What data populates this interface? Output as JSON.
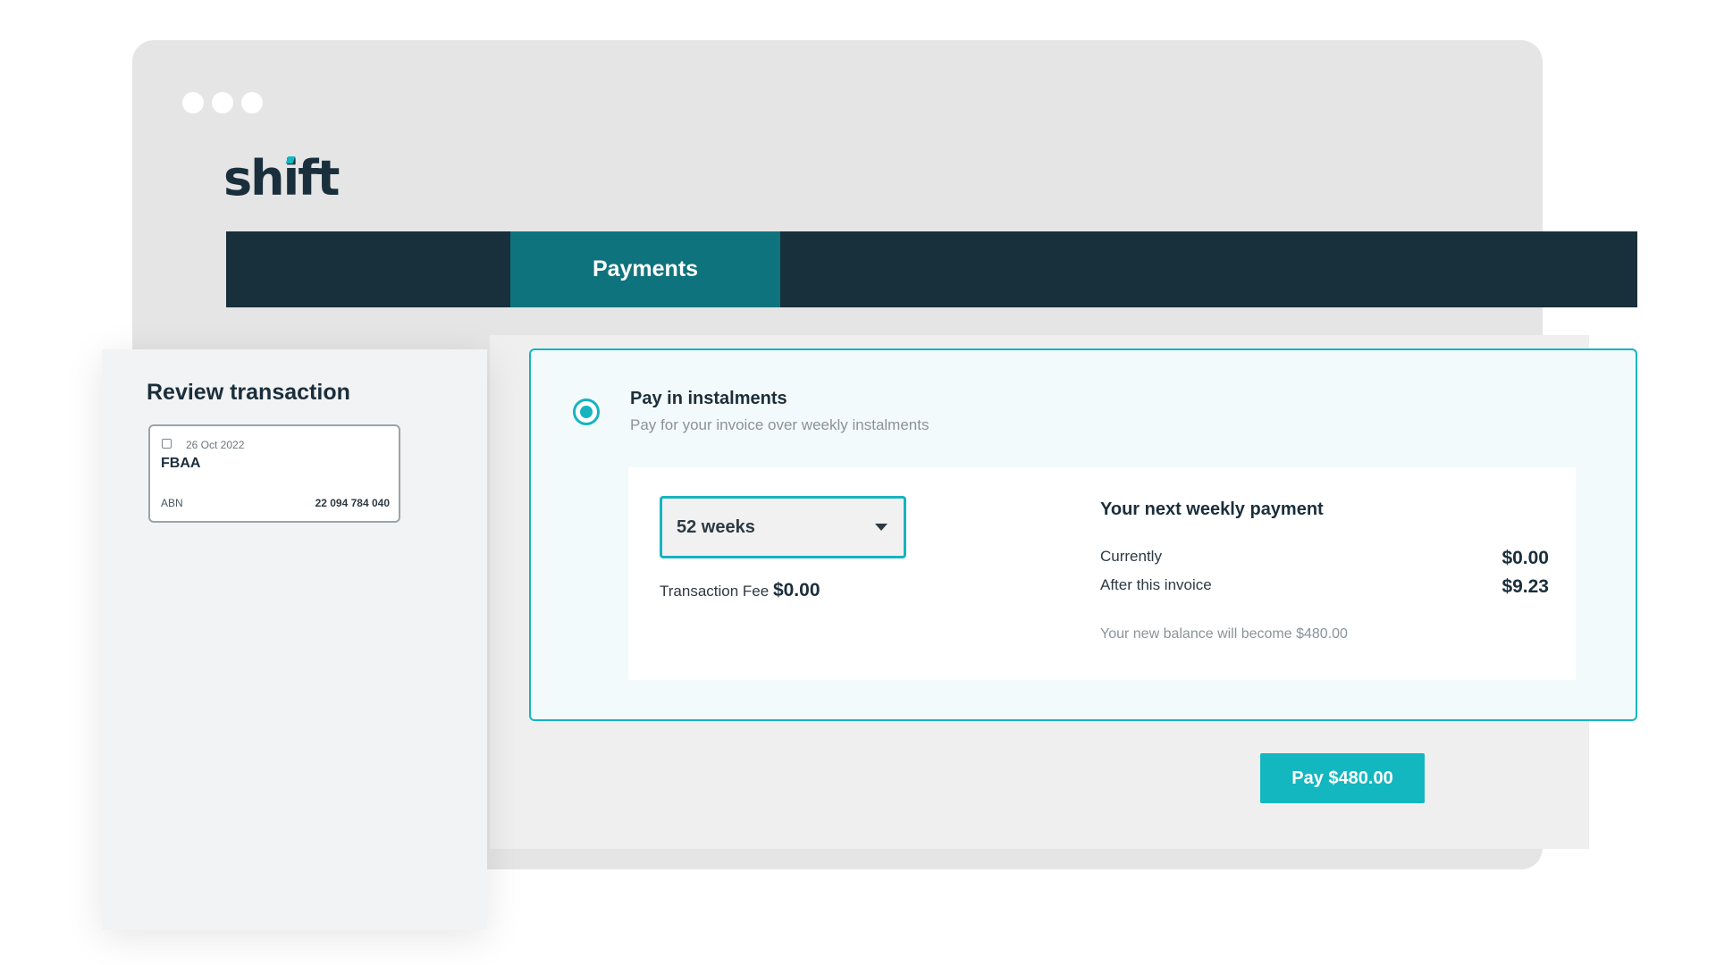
{
  "app": {
    "logo_text": "shift",
    "window_controls": [
      "dot",
      "dot",
      "dot"
    ]
  },
  "nav": {
    "active_tab": "Payments"
  },
  "review": {
    "title": "Review transaction",
    "transaction": {
      "date": "26 Oct 2022",
      "name": "FBAA",
      "abn_label": "ABN",
      "abn_value": "22 094 784 040"
    }
  },
  "instalments": {
    "title": "Pay in instalments",
    "subtitle": "Pay for your invoice over weekly instalments",
    "selected": true,
    "duration_select": {
      "value": "52 weeks"
    },
    "fee_label": "Transaction Fee",
    "fee_value": "$0.00",
    "next_payment": {
      "title": "Your next weekly payment",
      "currently_label": "Currently",
      "currently_value": "$0.00",
      "after_label": "After this invoice",
      "after_value": "$9.23",
      "balance_note": "Your new balance will become $480.00"
    }
  },
  "actions": {
    "pay_label": "Pay $480.00"
  },
  "colors": {
    "accent": "#16b4bf",
    "nav_dark": "#182f3c",
    "nav_active": "#0f737d",
    "text_dark": "#1b2e3b"
  }
}
